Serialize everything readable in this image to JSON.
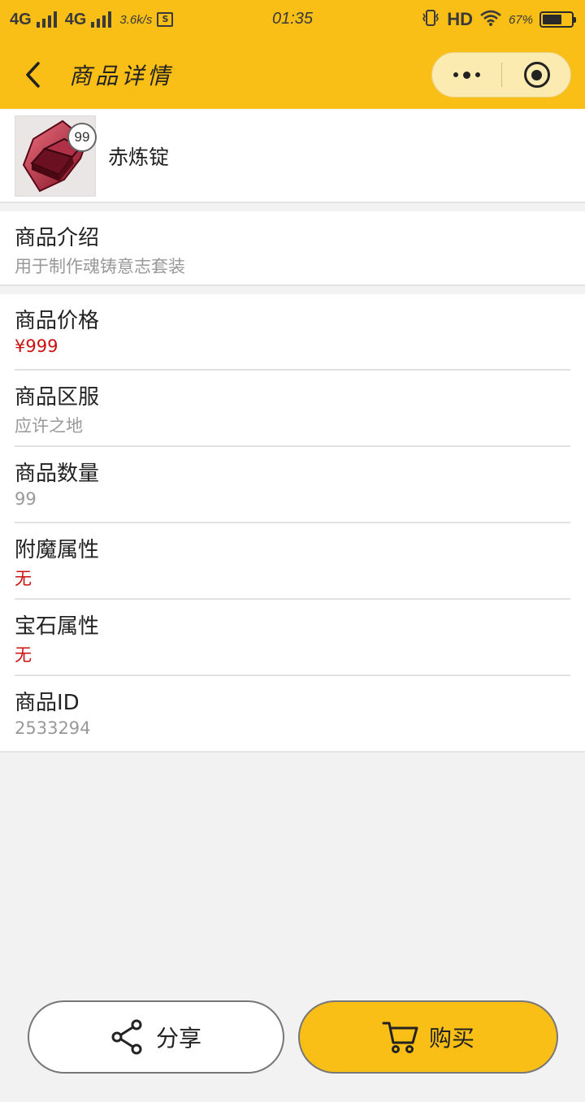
{
  "status_bar": {
    "network1": "4G",
    "network2": "4G",
    "speed": "3.6k/s",
    "sim_label": "S",
    "time": "01:35",
    "hd_label": "HD",
    "battery_text": "67%",
    "battery_level": 0.67
  },
  "nav": {
    "title": "商品详情"
  },
  "product": {
    "name": "赤炼锭",
    "badge": "99"
  },
  "intro": {
    "label": "商品介绍",
    "value": "用于制作魂铸意志套装"
  },
  "details": [
    {
      "label": "商品价格",
      "value": "¥999",
      "highlight": true
    },
    {
      "label": "商品区服",
      "value": "应许之地",
      "highlight": false
    },
    {
      "label": "商品数量",
      "value": "99",
      "highlight": false
    },
    {
      "label": "附魔属性",
      "value": "无",
      "highlight": true
    },
    {
      "label": "宝石属性",
      "value": "无",
      "highlight": true
    },
    {
      "label": "商品ID",
      "value": "2533294",
      "highlight": false
    }
  ],
  "actions": {
    "share_label": "分享",
    "buy_label": "购买"
  },
  "colors": {
    "accent": "#f9bf16",
    "price_red": "#cc1010"
  },
  "icons": {
    "share": "share-icon",
    "cart": "cart-icon",
    "back": "chevron-left-icon",
    "more": "more-dots-icon",
    "close": "target-icon"
  }
}
